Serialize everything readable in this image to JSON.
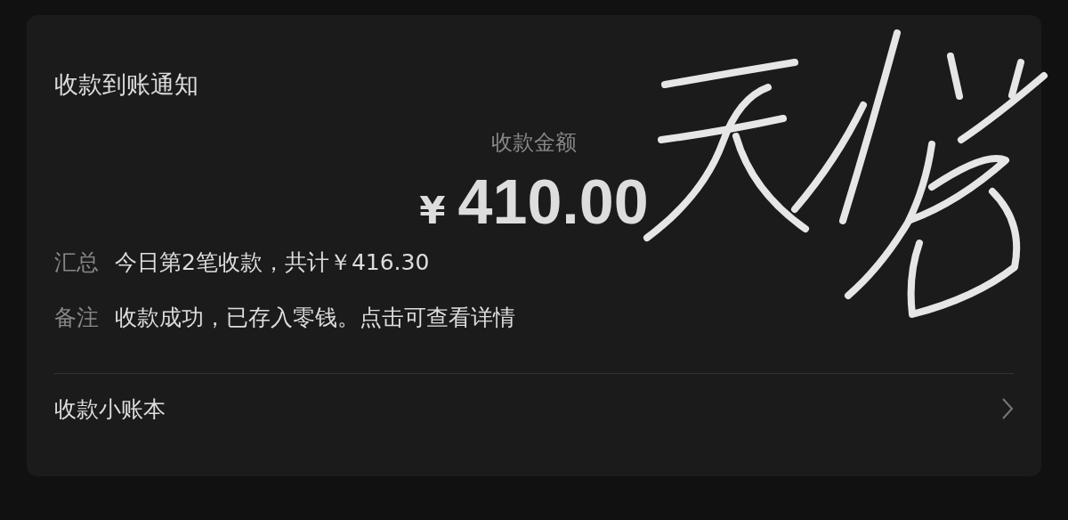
{
  "card": {
    "title": "收款到账通知",
    "amount_label": "收款金额",
    "currency": "¥",
    "amount": "410.00",
    "fields": [
      {
        "label": "汇总",
        "value": "今日第2笔收款，共计￥416.30"
      },
      {
        "label": "备注",
        "value": "收款成功，已存入零钱。点击可查看详情"
      }
    ],
    "link": {
      "label": "收款小账本"
    }
  }
}
